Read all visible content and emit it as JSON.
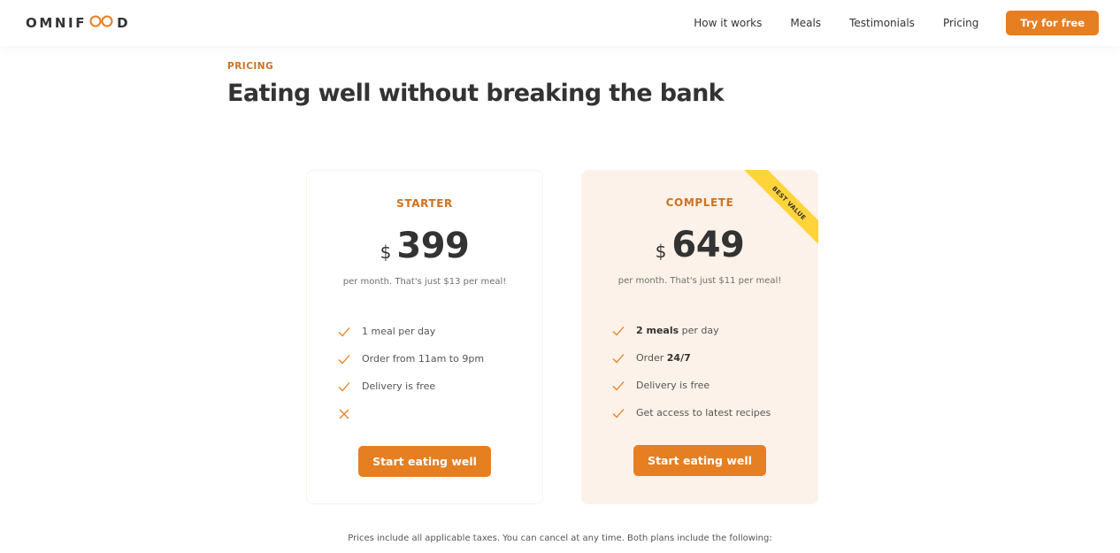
{
  "header": {
    "logo": {
      "left": "OMNIF",
      "right": "D"
    },
    "nav": [
      "How it works",
      "Meals",
      "Testimonials",
      "Pricing"
    ],
    "cta": "Try for free"
  },
  "section": {
    "subheading": "PRICING",
    "heading": "Eating well without breaking the bank"
  },
  "plans": [
    {
      "name": "STARTER",
      "currency": "$",
      "amount": "399",
      "note": "per month. That's just $13 per meal!",
      "features": [
        {
          "icon": "check-icon",
          "text": "1 meal per day"
        },
        {
          "icon": "check-icon",
          "text": "Order from 11am to 9pm"
        },
        {
          "icon": "check-icon",
          "text": "Delivery is free"
        },
        {
          "icon": "close-icon",
          "text": ""
        }
      ],
      "button": "Start eating well"
    },
    {
      "name": "COMPLETE",
      "currency": "$",
      "amount": "649",
      "note": "per month. That's just $11 per meal!",
      "ribbon": "BEST VALUE",
      "features": [
        {
          "icon": "check-icon",
          "bold": "2 meals",
          "text": " per day"
        },
        {
          "icon": "check-icon",
          "text": "Order ",
          "bold_after": "24/7"
        },
        {
          "icon": "check-icon",
          "text": "Delivery is free"
        },
        {
          "icon": "check-icon",
          "text": "Get access to latest recipes"
        }
      ],
      "button": "Start eating well"
    }
  ],
  "footnote": "Prices include all applicable taxes. You can cancel at any time. Both plans include the following:",
  "colors": {
    "accent": "#e67e22",
    "accent_dark": "#cf711f",
    "tint": "#fdf2e9",
    "ribbon": "#ffd43b",
    "text": "#333333"
  }
}
